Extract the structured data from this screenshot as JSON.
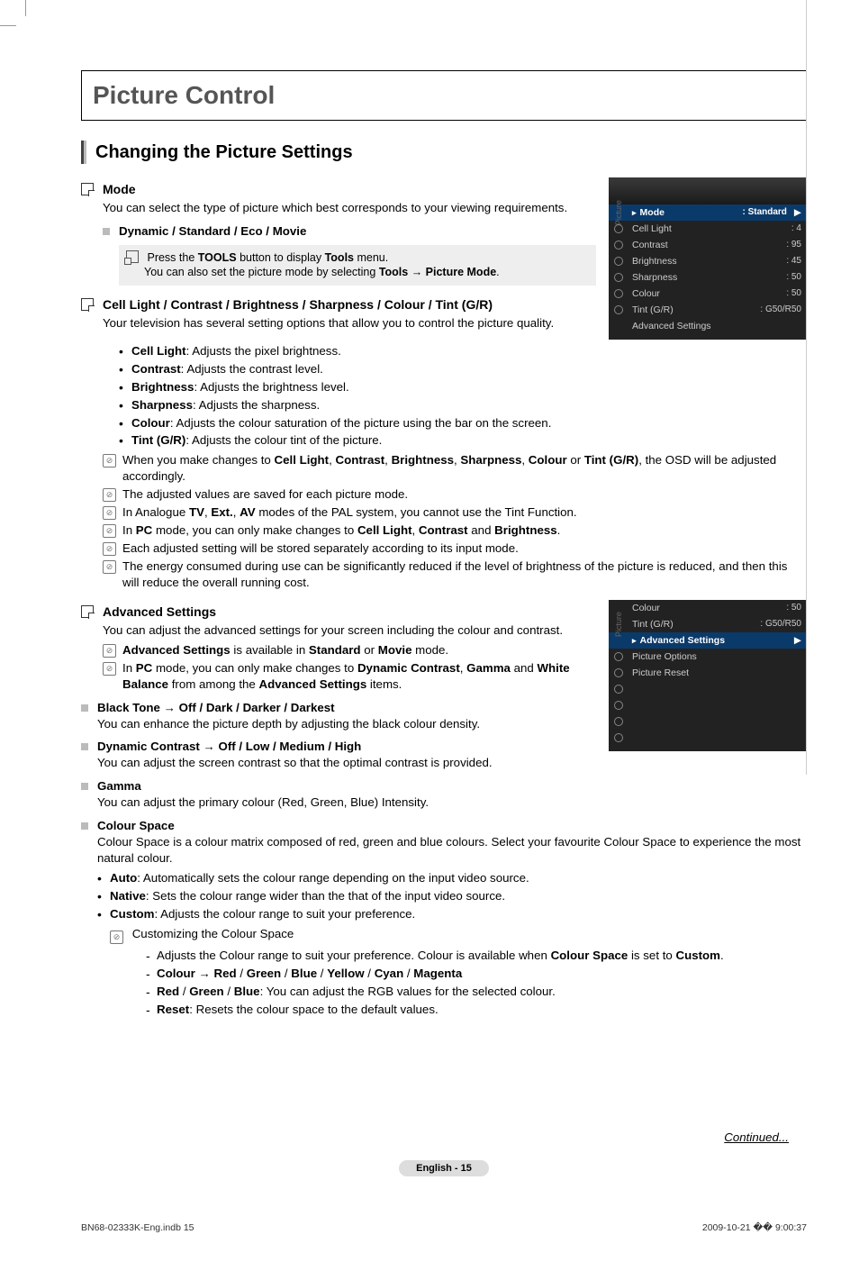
{
  "page": {
    "title": "Picture Control",
    "section": "Changing the Picture Settings",
    "continued": "Continued...",
    "badge": "English - 15"
  },
  "mode": {
    "heading": "Mode",
    "desc": "You can select the type of picture which best corresponds to your viewing requirements.",
    "sub": "Dynamic / Standard / Eco / Movie",
    "tools1_a": "Press the ",
    "tools1_b": "TOOLS",
    "tools1_c": " button to display ",
    "tools1_d": "Tools",
    "tools1_e": " menu.",
    "tools2_a": "You can also set the picture mode by selecting ",
    "tools2_b": "Tools",
    "tools2_c": " → ",
    "tools2_d": "Picture Mode",
    "tools2_e": "."
  },
  "params": {
    "heading": "Cell Light / Contrast / Brightness / Sharpness / Colour / Tint (G/R)",
    "desc": "Your television has several setting options that allow you to control the picture quality.",
    "b1_a": "Cell Light",
    "b1_b": ": Adjusts the pixel brightness.",
    "b2_a": "Contrast",
    "b2_b": ": Adjusts the contrast level.",
    "b3_a": "Brightness",
    "b3_b": ": Adjusts the brightness level.",
    "b4_a": "Sharpness",
    "b4_b": ": Adjusts the sharpness.",
    "b5_a": "Colour",
    "b5_b": ": Adjusts the colour saturation of the picture using the bar on the screen.",
    "b6_a": "Tint (G/R)",
    "b6_b": ": Adjusts the colour tint of the picture.",
    "n1_a": "When you make changes to ",
    "n1_b": "Cell Light",
    "n1_c": ", ",
    "n1_d": "Contrast",
    "n1_e": ", ",
    "n1_f": "Brightness",
    "n1_g": ", ",
    "n1_h": "Sharpness",
    "n1_i": ", ",
    "n1_j": "Colour",
    "n1_k": " or ",
    "n1_l": "Tint (G/R)",
    "n1_m": ", the OSD will be adjusted accordingly.",
    "n2": "The adjusted values are saved for each picture mode.",
    "n3_a": "In Analogue ",
    "n3_b": "TV",
    "n3_c": ", ",
    "n3_d": "Ext.",
    "n3_e": ", ",
    "n3_f": "AV",
    "n3_g": " modes of the PAL system, you cannot use the Tint Function.",
    "n4_a": "In ",
    "n4_b": "PC",
    "n4_c": " mode, you can only make changes to ",
    "n4_d": "Cell Light",
    "n4_e": ", ",
    "n4_f": "Contrast",
    "n4_g": " and ",
    "n4_h": "Brightness",
    "n4_i": ".",
    "n5": "Each adjusted setting will be stored separately according to its input mode.",
    "n6": "The energy consumed during use can be significantly reduced if the level of brightness of the picture is reduced, and then this will reduce the overall running cost."
  },
  "adv": {
    "heading": "Advanced Settings",
    "desc": "You can adjust the advanced settings for your screen including the colour and contrast.",
    "n1_a": "Advanced Settings",
    "n1_b": " is available in ",
    "n1_c": "Standard",
    "n1_d": " or ",
    "n1_e": "Movie",
    "n1_f": " mode.",
    "n2_a": "In ",
    "n2_b": "PC",
    "n2_c": " mode, you can only make changes to ",
    "n2_d": "Dynamic Contrast",
    "n2_e": ", ",
    "n2_f": "Gamma",
    "n2_g": " and ",
    "n2_h": "White Balance",
    "n2_i": " from among the ",
    "n2_j": "Advanced Settings",
    "n2_k": " items.",
    "bt_h": "Black Tone → Off / Dark / Darker / Darkest",
    "bt_d": "You can enhance the picture depth by adjusting the black colour density.",
    "dc_h": "Dynamic Contrast → Off / Low / Medium / High",
    "dc_d": "You can adjust the screen contrast so that the optimal contrast is provided.",
    "g_h": "Gamma",
    "g_d": "You can adjust the primary colour (Red, Green, Blue) Intensity.",
    "cs_h": "Colour Space",
    "cs_d": "Colour Space is a colour matrix composed of red, green and blue colours. Select your favourite Colour Space to experience the most natural colour.",
    "cs_b1_a": "Auto",
    "cs_b1_b": ": Automatically sets the colour range depending on the input video source.",
    "cs_b2_a": "Native",
    "cs_b2_b": ": Sets the colour range wider than the that of the input video source.",
    "cs_b3_a": "Custom",
    "cs_b3_b": ": Adjusts the colour range to suit your preference.",
    "cs_note": "Customizing the Colour Space",
    "cs_d1_a": "Adjusts the Colour range to suit your preference. Colour is available when ",
    "cs_d1_b": "Colour Space",
    "cs_d1_c": " is set to ",
    "cs_d1_d": "Custom",
    "cs_d1_e": ".",
    "cs_d2_a": "Colour",
    "cs_d2_b": " → ",
    "cs_d2_c": "Red",
    "cs_d2_d": " / ",
    "cs_d2_e": "Green",
    "cs_d2_f": " / ",
    "cs_d2_g": "Blue",
    "cs_d2_h": " / ",
    "cs_d2_i": "Yellow",
    "cs_d2_j": " / ",
    "cs_d2_k": "Cyan",
    "cs_d2_l": " / ",
    "cs_d2_m": "Magenta",
    "cs_d3_a": "Red",
    "cs_d3_b": " / ",
    "cs_d3_c": "Green",
    "cs_d3_d": " / ",
    "cs_d3_e": "Blue",
    "cs_d3_f": ": You can adjust the RGB values for the selected colour.",
    "cs_d4_a": "Reset",
    "cs_d4_b": ": Resets the colour space to the default values."
  },
  "osd1": {
    "side": "Picture",
    "rows": [
      {
        "label": "Mode",
        "value": ": Standard",
        "hl": true
      },
      {
        "label": "Cell Light",
        "value": ": 4"
      },
      {
        "label": "Contrast",
        "value": ": 95"
      },
      {
        "label": "Brightness",
        "value": ": 45"
      },
      {
        "label": "Sharpness",
        "value": ": 50"
      },
      {
        "label": "Colour",
        "value": ": 50"
      },
      {
        "label": "Tint (G/R)",
        "value": ": G50/R50"
      },
      {
        "label": "Advanced Settings",
        "value": ""
      }
    ]
  },
  "osd2": {
    "side": "Picture",
    "rows": [
      {
        "label": "Colour",
        "value": ": 50"
      },
      {
        "label": "Tint (G/R)",
        "value": ": G50/R50"
      },
      {
        "label": "Advanced Settings",
        "value": "",
        "hl": true
      },
      {
        "label": "Picture Options",
        "value": ""
      },
      {
        "label": "Picture Reset",
        "value": ""
      }
    ]
  },
  "footer": {
    "left": "BN68-02333K-Eng.indb   15",
    "right": "2009-10-21   �� 9:00:37"
  }
}
